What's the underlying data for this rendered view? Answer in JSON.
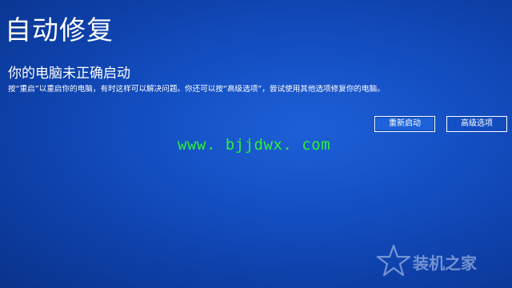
{
  "page": {
    "title": "自动修复",
    "heading": "你的电脑未正确启动",
    "description": "按“重启”以重启你的电脑，有时这样可以解决问题。你还可以按“高级选项”，尝试使用其他选项修复你的电脑。"
  },
  "buttons": {
    "restart_label": "重新启动",
    "advanced_label": "高级选项"
  },
  "watermark": {
    "url": "www. bjjdwx. com",
    "logo_text": "装机之家"
  },
  "colors": {
    "background": "#1450c4",
    "text": "#ffffff",
    "watermark_url": "#2cf03a"
  }
}
